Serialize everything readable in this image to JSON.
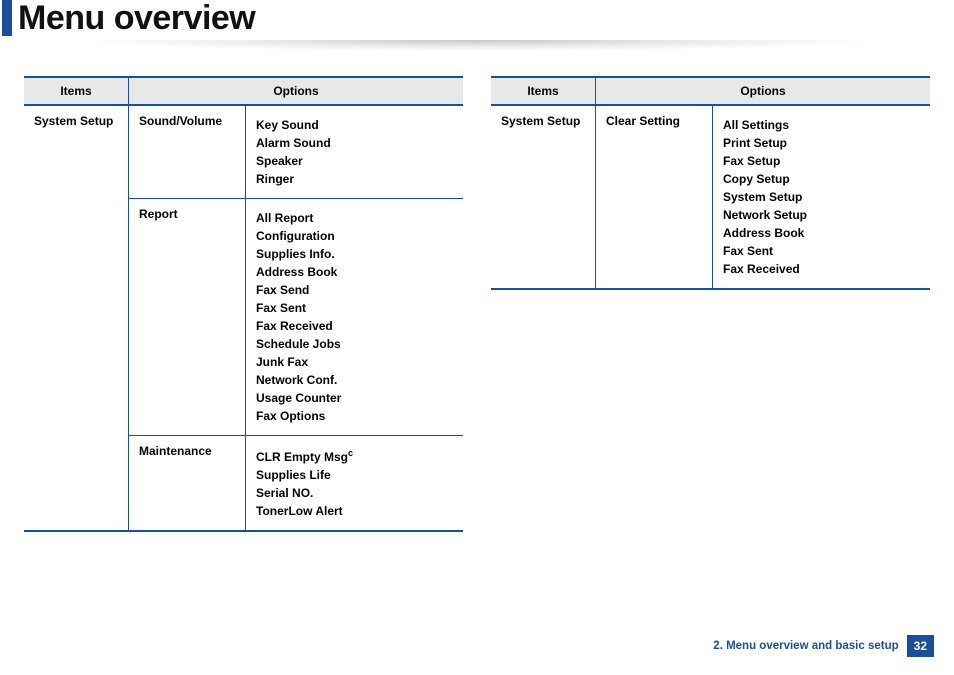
{
  "title": "Menu overview",
  "headers": {
    "items": "Items",
    "options": "Options"
  },
  "left": {
    "category": "System Setup",
    "groups": [
      {
        "name": "Sound/Volume",
        "options": [
          "Key Sound",
          "Alarm Sound",
          "Speaker",
          "Ringer"
        ],
        "sup": [
          null,
          null,
          null,
          null
        ]
      },
      {
        "name": "Report",
        "options": [
          "All Report",
          "Configuration",
          "Supplies Info.",
          "Address Book",
          "Fax Send",
          "Fax Sent",
          "Fax Received",
          "Schedule Jobs",
          "Junk Fax",
          "Network Conf.",
          "Usage Counter",
          "Fax Options"
        ],
        "sup": [
          null,
          null,
          null,
          null,
          null,
          null,
          null,
          null,
          null,
          null,
          null,
          null
        ]
      },
      {
        "name": "Maintenance",
        "options": [
          "CLR Empty Msg",
          "Supplies Life",
          "Serial NO.",
          "TonerLow Alert"
        ],
        "sup": [
          "c",
          null,
          null,
          null
        ]
      }
    ]
  },
  "right": {
    "category": "System Setup",
    "groups": [
      {
        "name": "Clear Setting",
        "options": [
          "All Settings",
          "Print Setup",
          "Fax Setup",
          "Copy Setup",
          "System Setup",
          "Network Setup",
          "Address Book",
          "Fax Sent",
          "Fax Received"
        ],
        "sup": [
          null,
          null,
          null,
          null,
          null,
          null,
          null,
          null,
          null
        ]
      }
    ]
  },
  "footer": {
    "chapter": "2. Menu overview and basic setup",
    "page": "32"
  }
}
